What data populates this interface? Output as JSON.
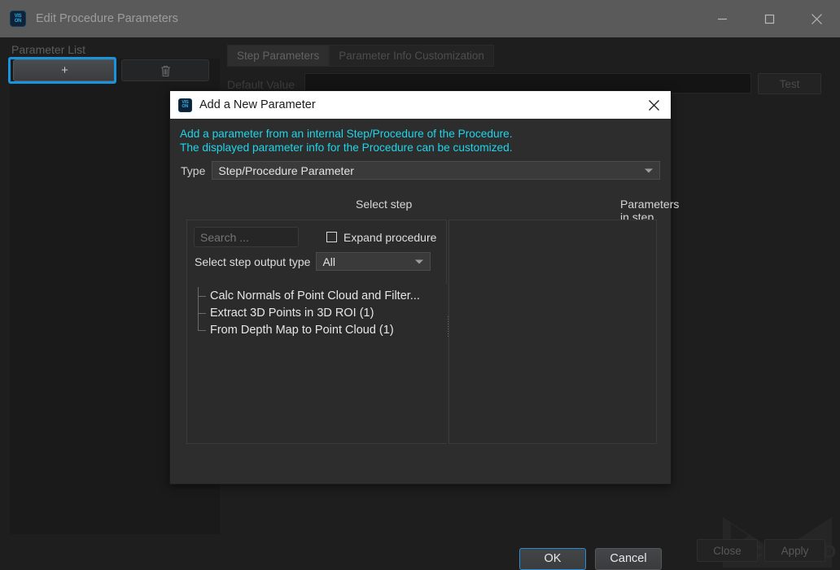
{
  "main_window": {
    "title": "Edit Procedure Parameters",
    "app_icon": "mech-vision-icon",
    "window_controls": {
      "minimize": "minimize-icon",
      "maximize": "maximize-icon",
      "close": "close-icon"
    },
    "parameter_list": {
      "label": "Parameter List",
      "add_button": "+",
      "delete_button": "trash-icon",
      "highlight_color": "#1a93dd"
    },
    "tabs": [
      {
        "label": "Step Parameters",
        "active": true
      },
      {
        "label": "Parameter Info Customization",
        "active": false
      }
    ],
    "default_value": {
      "label": "Default Value",
      "value": "",
      "test_button": "Test"
    },
    "footer": {
      "close_button": "Close",
      "apply_button": "Apply"
    },
    "watermark": "MECH MIND"
  },
  "dialog": {
    "icon": "mech-vision-icon",
    "title": "Add a New Parameter",
    "close_icon": "close-icon",
    "description_line1": "Add a parameter from an internal Step/Procedure of the Procedure.",
    "description_line2": "The displayed parameter info for the Procedure can be customized.",
    "description_color": "#1ed5ea",
    "type": {
      "label": "Type",
      "value": "Step/Procedure Parameter",
      "options": [
        "Step/Procedure Parameter"
      ]
    },
    "select_step": {
      "label": "Select step",
      "search_placeholder": "Search ...",
      "search_value": "",
      "expand_procedure": {
        "label": "Expand procedure",
        "checked": false
      },
      "output_type": {
        "label": "Select step output type",
        "value": "All",
        "options": [
          "All"
        ]
      },
      "tree_items": [
        "Calc Normals of Point Cloud and Filter...",
        "Extract 3D Points in 3D ROI (1)",
        "From Depth Map to Point Cloud (1)"
      ]
    },
    "parameters_in_step": {
      "label": "Parameters in step",
      "items": []
    },
    "buttons": {
      "ok": "OK",
      "cancel": "Cancel"
    }
  }
}
